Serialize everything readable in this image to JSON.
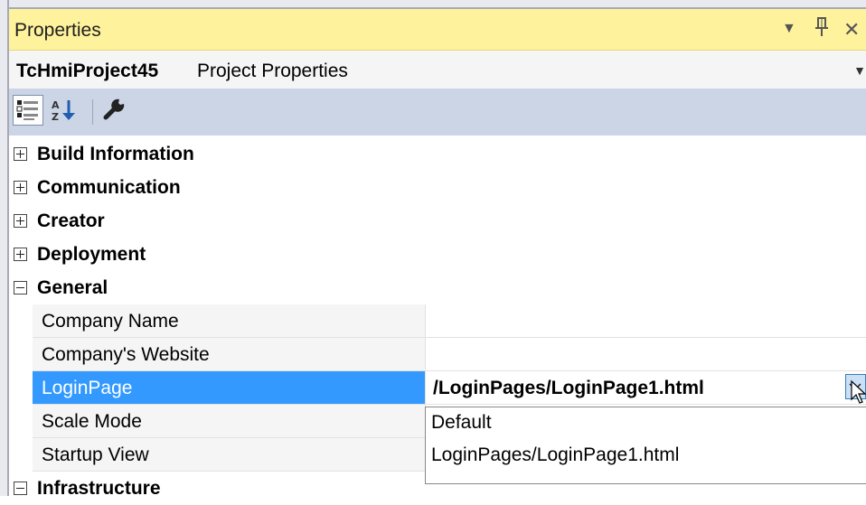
{
  "panel": {
    "title": "Properties",
    "window_icons": [
      "dropdown-arrow-icon",
      "pin-icon",
      "close-icon"
    ]
  },
  "subject": {
    "name": "TcHmiProject45",
    "type": "Project Properties"
  },
  "toolbar": {
    "buttons": [
      "categorized-icon",
      "alphabetical-sort-icon",
      "property-pages-wrench-icon"
    ]
  },
  "categories": {
    "build_information": "Build Information",
    "communication": "Communication",
    "creator": "Creator",
    "deployment": "Deployment",
    "general": "General",
    "infrastructure": "Infrastructure"
  },
  "general_properties": [
    {
      "label": "Company Name",
      "value": ""
    },
    {
      "label": "Company's Website",
      "value": ""
    },
    {
      "label": "LoginPage",
      "value": "/LoginPages/LoginPage1.html"
    },
    {
      "label": "Scale Mode",
      "value": ""
    },
    {
      "label": "Startup View",
      "value": ""
    }
  ],
  "dropdown": {
    "options": [
      "Default",
      "LoginPages/LoginPage1.html"
    ]
  },
  "colors": {
    "title_bar": "#fff29d",
    "toolbar": "#ccd5e6",
    "selection": "#3399ff"
  }
}
